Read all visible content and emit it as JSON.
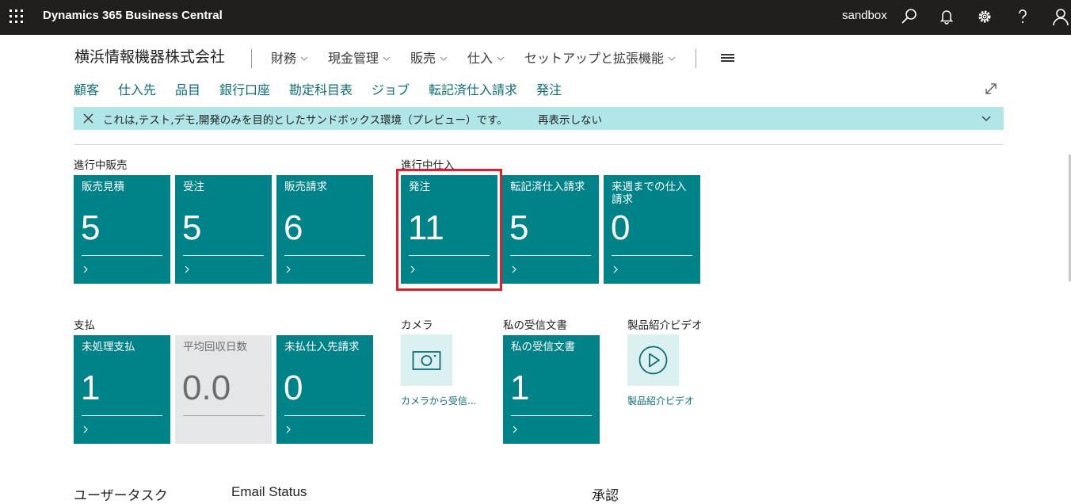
{
  "topbar": {
    "app_title": "Dynamics 365 Business Central",
    "environment": "sandbox",
    "icons": [
      "waffle-icon",
      "search-icon",
      "bell-icon",
      "gear-icon",
      "help-icon",
      "user-icon"
    ]
  },
  "header": {
    "company": "横浜情報機器株式会社",
    "menus": [
      "財務",
      "現金管理",
      "販売",
      "仕入",
      "セットアップと拡張機能"
    ]
  },
  "nav": {
    "items": [
      "顧客",
      "仕入先",
      "品目",
      "銀行口座",
      "勘定科目表",
      "ジョブ",
      "転記済仕入請求",
      "発注"
    ]
  },
  "banner": {
    "text": "これは,テスト,デモ,開発のみを目的としたサンドボックス環境（プレビュー）です。",
    "link": "再表示しない"
  },
  "groups": {
    "sales": {
      "label": "進行中販売",
      "tiles": [
        {
          "label": "販売見積",
          "value": "5"
        },
        {
          "label": "受注",
          "value": "5"
        },
        {
          "label": "販売請求",
          "value": "6"
        }
      ]
    },
    "purchase": {
      "label": "進行中仕入",
      "tiles": [
        {
          "label": "発注",
          "value": "11"
        },
        {
          "label": "転記済仕入請求",
          "value": "5"
        },
        {
          "label": "来週までの仕入請求",
          "value": "0"
        }
      ]
    },
    "payments": {
      "label": "支払",
      "tiles": [
        {
          "label": "未処理支払",
          "value": "1"
        },
        {
          "label": "平均回収日数",
          "value": "0.0"
        },
        {
          "label": "未払仕入先請求",
          "value": "0"
        }
      ]
    },
    "camera": {
      "label": "カメラ",
      "caption": "カメラから受信..."
    },
    "inbox": {
      "label": "私の受信文書",
      "tile": {
        "label": "私の受信文書",
        "value": "1"
      }
    },
    "video": {
      "label": "製品紹介ビデオ",
      "caption": "製品紹介ビデオ"
    }
  },
  "sections": [
    "ユーザータスク",
    "Email Status",
    "承認"
  ],
  "colors": {
    "tile": "#008289",
    "tile_gray": "#e5e6e8",
    "banner": "#b1e6e9",
    "topbar": "#201f1e",
    "highlight": "#e01f2c",
    "link": "#0e6d74"
  }
}
